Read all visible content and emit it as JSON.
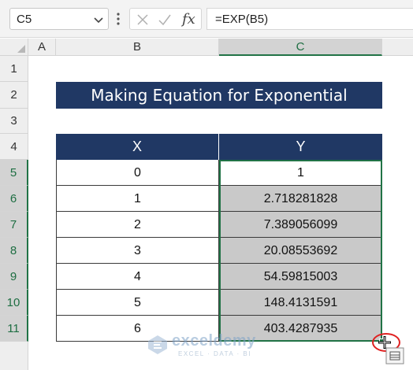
{
  "formula_bar": {
    "name_box": "C5",
    "fx_label": "fx",
    "formula": "=EXP(B5)"
  },
  "columns": [
    "A",
    "B",
    "C"
  ],
  "selected_column": "C",
  "rows": [
    "1",
    "2",
    "3",
    "4",
    "5",
    "6",
    "7",
    "8",
    "9",
    "10",
    "11"
  ],
  "selected_rows": [
    "5",
    "6",
    "7",
    "8",
    "9",
    "10",
    "11"
  ],
  "sheet": {
    "title": "Making Equation for Exponential",
    "table": {
      "headers": [
        "X",
        "Y"
      ],
      "rows": [
        {
          "x": "0",
          "y": "1"
        },
        {
          "x": "1",
          "y": "2.718281828"
        },
        {
          "x": "2",
          "y": "7.389056099"
        },
        {
          "x": "3",
          "y": "20.08553692"
        },
        {
          "x": "4",
          "y": "54.59815003"
        },
        {
          "x": "5",
          "y": "148.4131591"
        },
        {
          "x": "6",
          "y": "403.4287935"
        }
      ]
    }
  },
  "watermark": {
    "name": "exceldemy",
    "tagline": "EXCEL · DATA · BI"
  },
  "colors": {
    "header_fill": "#203864",
    "selection": "#217346",
    "highlight_fill": "#c9c9c9",
    "annotation_ring": "#e02020"
  }
}
